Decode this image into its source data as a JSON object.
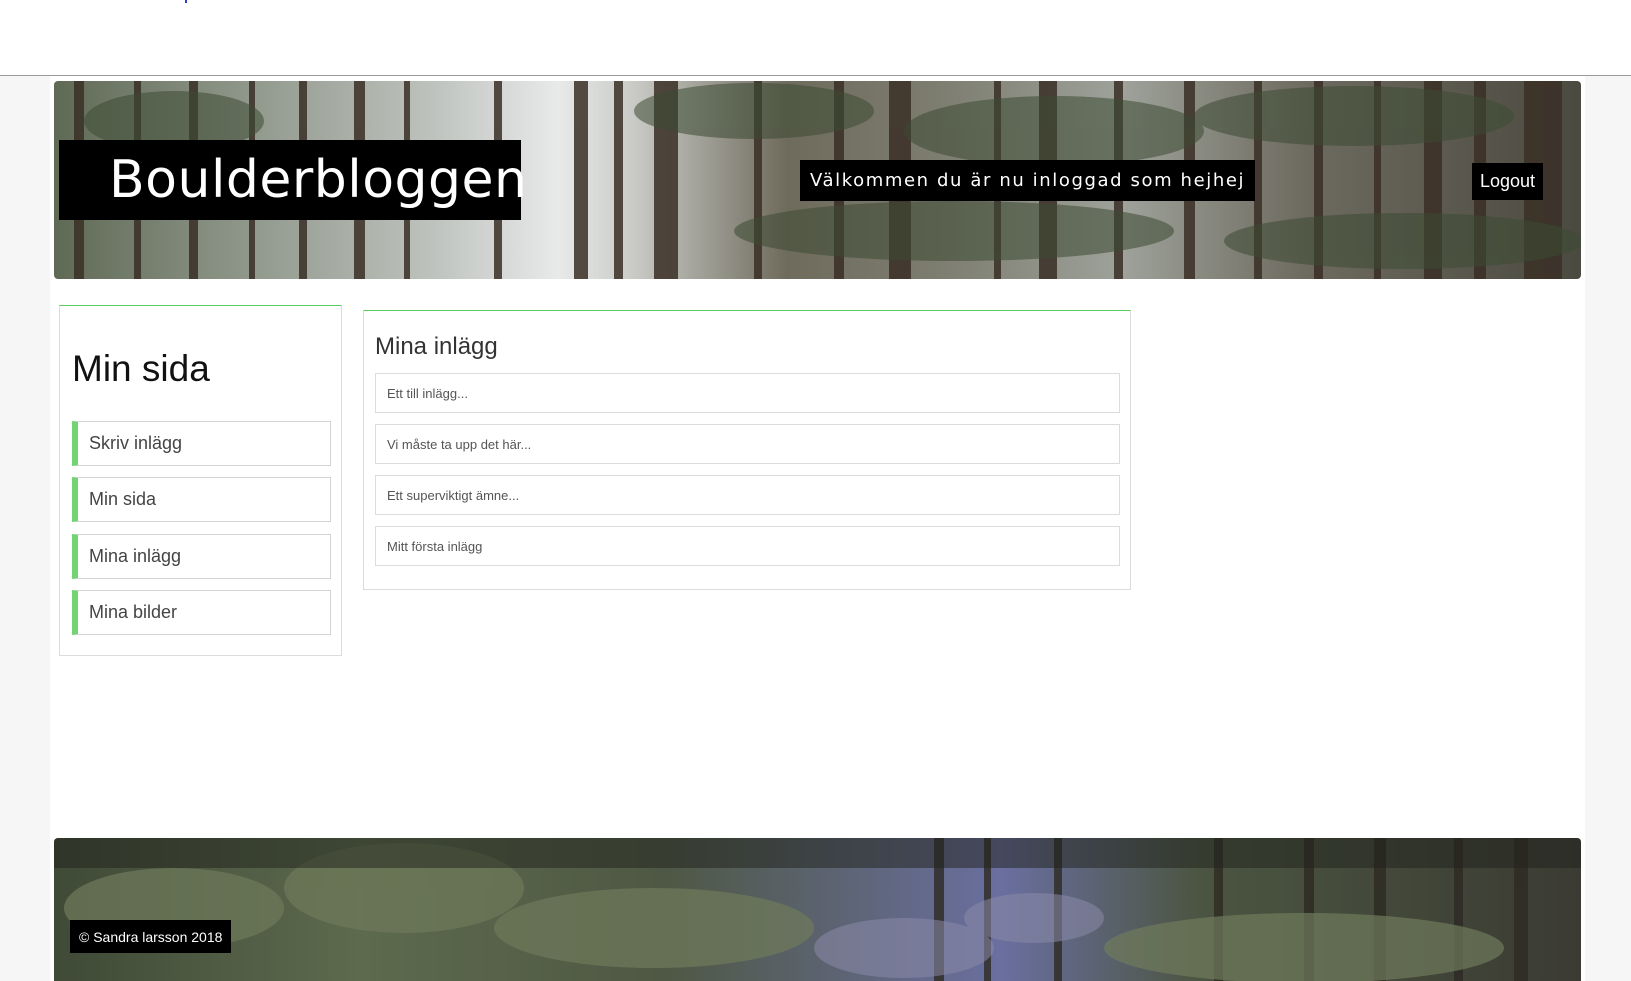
{
  "header": {
    "brand_title": "Boulderbloggen",
    "welcome_text": "Välkommen du är nu inloggad som hejhej",
    "logout_label": "Logout"
  },
  "sidebar": {
    "title": "Min sida",
    "items": [
      {
        "label": "Skriv inlägg"
      },
      {
        "label": "Min sida"
      },
      {
        "label": "Mina inlägg"
      },
      {
        "label": "Mina bilder"
      }
    ]
  },
  "posts": {
    "title": "Mina inlägg",
    "items": [
      {
        "title": "Ett till inlägg..."
      },
      {
        "title": "Vi måste ta upp det här..."
      },
      {
        "title": "Ett superviktigt ämne..."
      },
      {
        "title": "Mitt första inlägg"
      }
    ]
  },
  "footer": {
    "copyright": "© Sandra larsson 2018"
  },
  "colors": {
    "accent_green": "#72d572",
    "label_background": "#000000"
  }
}
